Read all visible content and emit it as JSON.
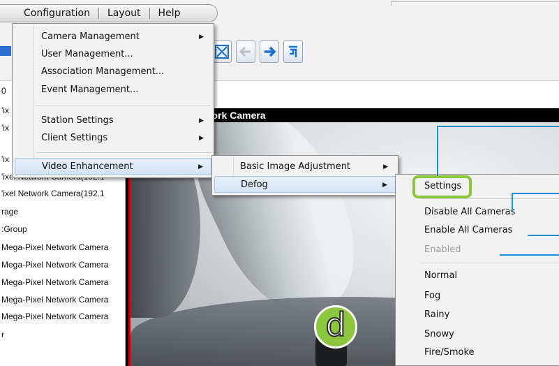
{
  "menubar": {
    "items": [
      "Configuration",
      "Layout",
      "Help"
    ]
  },
  "tree": {
    "items": [
      "0",
      "'ix",
      "'ix",
      "'ix",
      "'ixel Network Camera(192.1",
      "'ixel Network Camera(192.1",
      "rage",
      ":Group",
      "Mega-Pixel Network Camera",
      "Mega-Pixel Network Camera",
      "Mega-Pixel Network Camera",
      "Mega-Pixel Network Camera",
      "Mega-Pixel Network Camera",
      "r"
    ]
  },
  "video": {
    "title": "twork Camera"
  },
  "config_menu": {
    "items": [
      "Camera Management",
      "User Management...",
      "Association Management...",
      "Event Management...",
      "Station Settings",
      "Client Settings",
      "Video Enhancement"
    ]
  },
  "video_enhancement_menu": {
    "items": [
      "Basic Image Adjustment",
      "Defog"
    ]
  },
  "defog_menu": {
    "items": [
      "Settings",
      "Disable All Cameras",
      "Enable All Cameras",
      "Enabled",
      "Normal",
      "Fog",
      "Rainy",
      "Snowy",
      "Fire/Smoke"
    ]
  },
  "badge": {
    "letter": "d"
  },
  "colors": {
    "highlight_green": "#8cc63f",
    "callout_blue": "#1f8fd6",
    "video_border_red": "#c00000"
  },
  "icons": [
    "fit-window-icon",
    "back-arrow-icon",
    "forward-arrow-icon",
    "return-icon"
  ]
}
